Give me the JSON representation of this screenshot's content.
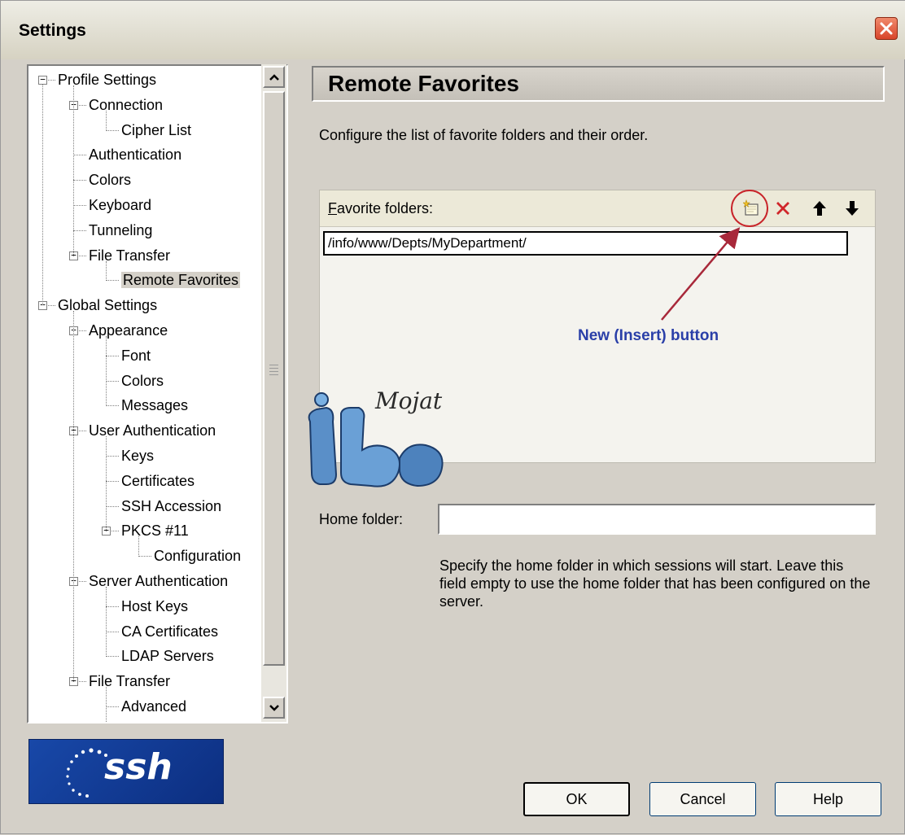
{
  "window": {
    "title": "Settings"
  },
  "tree": {
    "items": [
      {
        "label": "Profile Settings",
        "level": 0,
        "expanded": true
      },
      {
        "label": "Connection",
        "level": 1,
        "expanded": true
      },
      {
        "label": "Cipher List",
        "level": 2
      },
      {
        "label": "Authentication",
        "level": 1
      },
      {
        "label": "Colors",
        "level": 1
      },
      {
        "label": "Keyboard",
        "level": 1
      },
      {
        "label": "Tunneling",
        "level": 1
      },
      {
        "label": "File Transfer",
        "level": 1,
        "expanded": true
      },
      {
        "label": "Remote Favorites",
        "level": 2,
        "selected": true
      },
      {
        "label": "Global Settings",
        "level": 0,
        "expanded": true
      },
      {
        "label": "Appearance",
        "level": 1,
        "expanded": true
      },
      {
        "label": "Font",
        "level": 2
      },
      {
        "label": "Colors",
        "level": 2
      },
      {
        "label": "Messages",
        "level": 2
      },
      {
        "label": "User Authentication",
        "level": 1,
        "expanded": true
      },
      {
        "label": "Keys",
        "level": 2
      },
      {
        "label": "Certificates",
        "level": 2
      },
      {
        "label": "SSH Accession",
        "level": 2
      },
      {
        "label": "PKCS #11",
        "level": 2,
        "expanded": true
      },
      {
        "label": "Configuration",
        "level": 3
      },
      {
        "label": "Server Authentication",
        "level": 1,
        "expanded": true
      },
      {
        "label": "Host Keys",
        "level": 2
      },
      {
        "label": "CA Certificates",
        "level": 2
      },
      {
        "label": "LDAP Servers",
        "level": 2
      },
      {
        "label": "File Transfer",
        "level": 1,
        "expanded": true
      },
      {
        "label": "Advanced",
        "level": 2
      }
    ]
  },
  "logo": {
    "text": "ssh",
    "brand_color": "#1848a8"
  },
  "page": {
    "heading": "Remote Favorites",
    "description": "Configure the list of favorite folders and their order."
  },
  "favorites": {
    "label_underlined_char": "F",
    "label_rest": "avorite folders:",
    "toolbar": {
      "new_icon": "new-insert-icon",
      "delete_icon": "delete-icon",
      "up_icon": "move-up-icon",
      "down_icon": "move-down-icon"
    },
    "entries": [
      "/info/www/Depts/MyDepartment/"
    ]
  },
  "annotation": {
    "text": "New (Insert) button",
    "color": "#c8242a"
  },
  "watermark": {
    "text": "Mojat"
  },
  "home_folder": {
    "label": "Home folder:",
    "value": "",
    "help": "Specify the home folder in which sessions will start. Leave this field empty to use the home folder that has been configured on the server."
  },
  "buttons": {
    "ok": "OK",
    "cancel": "Cancel",
    "help": "Help"
  }
}
